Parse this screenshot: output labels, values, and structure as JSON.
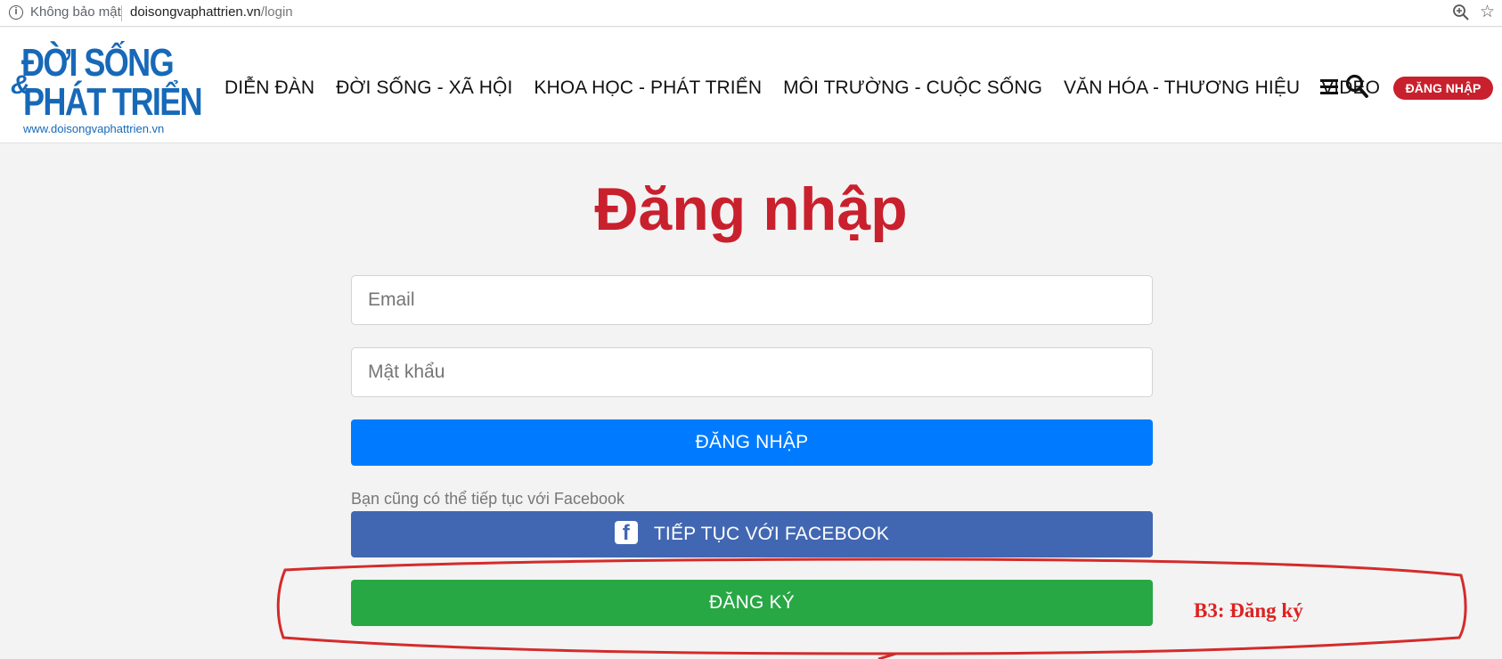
{
  "browser": {
    "security_label": "Không bảo mật",
    "url_domain": "doisongvaphattrien.vn",
    "url_path": "/login"
  },
  "logo": {
    "line1": "ĐỜI SỐNG",
    "amp": "&",
    "line2": "PHÁT TRIỂN",
    "url": "www.doisongvaphattrien.vn",
    "color": "#1769b8"
  },
  "nav": {
    "items": [
      {
        "label": "DIỄN ĐÀN"
      },
      {
        "label": "ĐỜI SỐNG - XÃ HỘI"
      },
      {
        "label": "KHOA HỌC - PHÁT TRIỂN"
      },
      {
        "label": "MÔI TRƯỜNG - CUỘC SỐNG"
      },
      {
        "label": "VĂN HÓA - THƯƠNG HIỆU"
      },
      {
        "label": "VIDEO"
      }
    ],
    "menu_icon": "hamburger-icon",
    "search_icon": "search-icon",
    "login_label": "ĐĂNG NHẬP"
  },
  "form": {
    "title": "Đăng nhập",
    "email_placeholder": "Email",
    "password_placeholder": "Mật khẩu",
    "login_button": "ĐĂNG NHẬP",
    "facebook_hint": "Bạn cũng có thể tiếp tục với Facebook",
    "facebook_button": "TIẾP TỤC VỚI FACEBOOK",
    "facebook_icon": "facebook-icon",
    "register_button": "ĐĂNG KÝ"
  },
  "annotation": {
    "text": "B3: Đăng ký"
  },
  "colors": {
    "accent_red": "#c9202d",
    "login_blue": "#007bff",
    "facebook_blue": "#4267b2",
    "register_green": "#28a745"
  }
}
